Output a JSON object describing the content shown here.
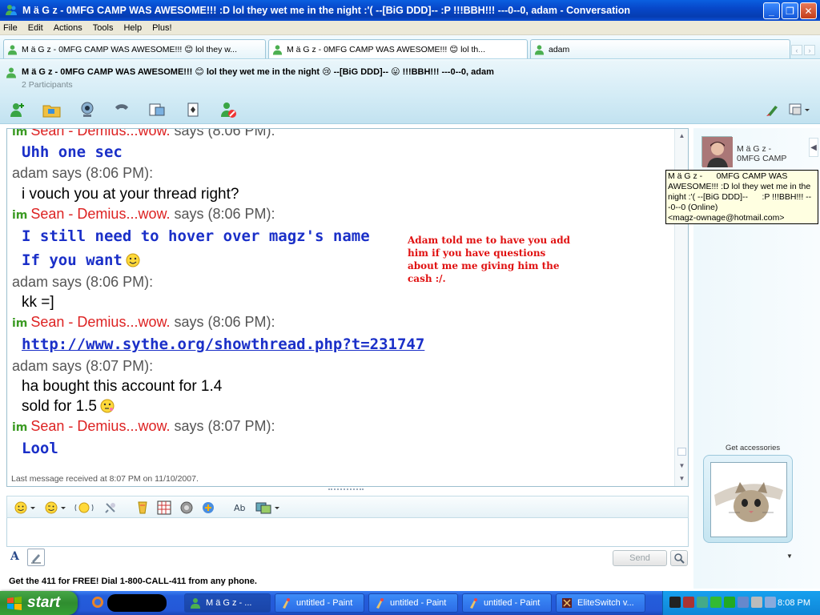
{
  "window": {
    "title": "M ä G z -      0MFG CAMP WAS AWESOME!!! :D lol they wet me in the night :'( --[BiG DDD]--     :P !!!BBH!!! ---0--0, adam - Conversation",
    "buttons": {
      "minimize": "_",
      "maximize": "❐",
      "close": "✕"
    }
  },
  "menu": [
    "File",
    "Edit",
    "Actions",
    "Tools",
    "Help",
    "Plus!"
  ],
  "tabs": [
    {
      "label": "M ä G z -      0MFG CAMP WAS AWESOME!!! 😊 lol they w..."
    },
    {
      "label": "M ä G z -      0MFG CAMP WAS AWESOME!!! 😊 lol th..."
    },
    {
      "label": "adam"
    }
  ],
  "conversation_header": {
    "names": "M ä G z -      0MFG CAMP WAS AWESOME!!! 😊 lol they wet me in the night 😢 --[BiG DDD]--      😛 !!!BBH!!! ---0--0, adam",
    "participants": "2 Participants"
  },
  "history": {
    "lines": [
      {
        "type": "says-sean",
        "speaker": "Sean - Demius...wow.",
        "time": "says (8:06 PM):"
      },
      {
        "type": "msg-sean",
        "text": "Uhh one sec"
      },
      {
        "type": "says-adam",
        "speaker": "adam",
        "time": "says (8:06 PM):"
      },
      {
        "type": "msg-adam",
        "text": "i vouch you at your thread right?"
      },
      {
        "type": "says-sean",
        "speaker": "Sean - Demius...wow.",
        "time": "says (8:06 PM):"
      },
      {
        "type": "msg-sean",
        "text": "I still need to hover over magz's name"
      },
      {
        "type": "msg-sean",
        "text": "If you want"
      },
      {
        "type": "says-adam",
        "speaker": "adam",
        "time": "says (8:06 PM):"
      },
      {
        "type": "msg-adam",
        "text": "kk =]"
      },
      {
        "type": "says-sean",
        "speaker": "Sean - Demius...wow.",
        "time": "says (8:06 PM):"
      },
      {
        "type": "msg-link",
        "text": "http://www.sythe.org/showthread.php?t=231747"
      },
      {
        "type": "says-adam",
        "speaker": "adam",
        "time": "says (8:07 PM):"
      },
      {
        "type": "msg-adam",
        "text": "ha bought this account for 1.4"
      },
      {
        "type": "msg-adam",
        "text": "sold for 1.5"
      },
      {
        "type": "says-sean",
        "speaker": "Sean - Demius...wow.",
        "time": "says (8:07 PM):"
      },
      {
        "type": "msg-sean",
        "text": "Lool"
      }
    ],
    "status": "Last message received at 8:07 PM on 11/10/2007.",
    "im_logo": "im"
  },
  "annotation": "Adam told me to have you add him if you have questions about me me giving him the cash :/.",
  "tooltip": "M ä G z -      0MFG CAMP WAS AWESOME!!! :D lol they wet me in the night :'( --[BiG DDD]--      :P !!!BBH!!! ---0--0 (Online)\n<magz-ownage@hotmail.com>",
  "contact_panel": {
    "name_line1": "M ä G z -",
    "name_line2": "0MFG CAMP",
    "accessories_label": "Get accessories"
  },
  "input": {
    "send_label": "Send",
    "font_label": "A"
  },
  "ad_text": "Get the 411 for FREE! Dial 1-800-CALL-411 from any phone.",
  "taskbar": {
    "start_label": "start",
    "tasks": [
      {
        "label": "M ä G z - ..."
      },
      {
        "label": "untitled - Paint"
      },
      {
        "label": "untitled - Paint"
      },
      {
        "label": "untitled - Paint"
      },
      {
        "label": "EliteSwitch v..."
      }
    ],
    "clock": "8:08 PM"
  },
  "colors": {
    "sean": "#dd2222",
    "sean_message": "#1a2fc8",
    "annotation": "#e01010",
    "titlebar": "#0747c9"
  }
}
